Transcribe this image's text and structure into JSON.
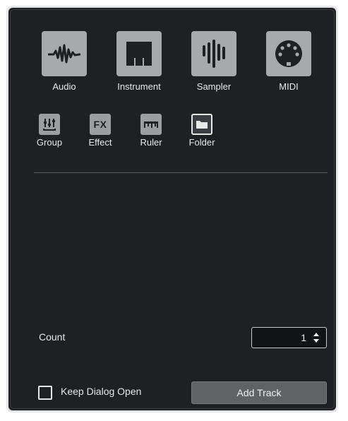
{
  "dialog": {
    "track_types": [
      {
        "label": "Audio",
        "icon": "audio-waveform-icon"
      },
      {
        "label": "Instrument",
        "icon": "piano-keys-icon"
      },
      {
        "label": "Sampler",
        "icon": "sampler-bars-icon"
      },
      {
        "label": "MIDI",
        "icon": "midi-connector-icon"
      }
    ],
    "other_types": [
      {
        "label": "Group",
        "icon": "group-faders-icon"
      },
      {
        "label": "Effect",
        "icon": "fx-icon",
        "icon_text": "FX"
      },
      {
        "label": "Ruler",
        "icon": "ruler-icon"
      },
      {
        "label": "Folder",
        "icon": "folder-icon",
        "selected": true
      }
    ],
    "count": {
      "label": "Count",
      "value": "1"
    },
    "keep_open": {
      "label": "Keep Dialog Open",
      "checked": false
    },
    "add_button": "Add Track"
  },
  "colors": {
    "background": "#1f2023",
    "tile": "#a8a9ad",
    "text": "#e9e9ea"
  }
}
